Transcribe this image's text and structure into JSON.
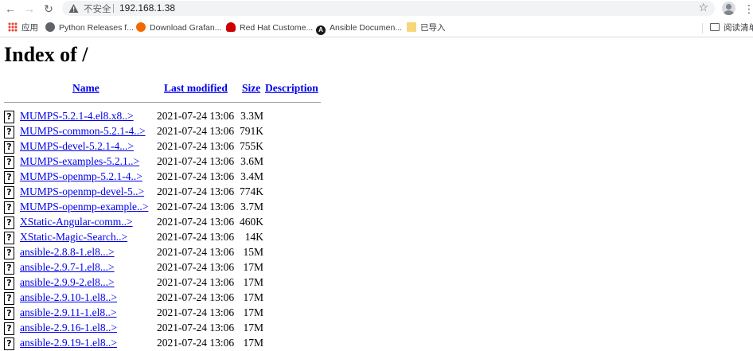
{
  "browser": {
    "security_label": "不安全",
    "url": "192.168.1.38",
    "bookmarks": [
      {
        "label": "应用",
        "icon": "apps-icon"
      },
      {
        "label": "Python Releases f...",
        "icon": "python-icon"
      },
      {
        "label": "Download Grafan...",
        "icon": "grafana-icon"
      },
      {
        "label": "Red Hat Custome...",
        "icon": "redhat-icon"
      },
      {
        "label": "Ansible Documen...",
        "icon": "ansible-icon"
      },
      {
        "label": "已导入",
        "icon": "folder-icon"
      }
    ],
    "reading_list": "阅读清单"
  },
  "page": {
    "title": "Index of /",
    "headers": {
      "name": "Name",
      "last_modified": "Last modified",
      "size": "Size",
      "description": "Description"
    },
    "icon_glyph": "?",
    "files": [
      {
        "name": "MUMPS-5.2.1-4.el8.x8..>",
        "modified": "2021-07-24 13:06",
        "size": "3.3M"
      },
      {
        "name": "MUMPS-common-5.2.1-4..>",
        "modified": "2021-07-24 13:06",
        "size": "791K"
      },
      {
        "name": "MUMPS-devel-5.2.1-4...>",
        "modified": "2021-07-24 13:06",
        "size": "755K"
      },
      {
        "name": "MUMPS-examples-5.2.1..>",
        "modified": "2021-07-24 13:06",
        "size": "3.6M"
      },
      {
        "name": "MUMPS-openmp-5.2.1-4..>",
        "modified": "2021-07-24 13:06",
        "size": "3.4M"
      },
      {
        "name": "MUMPS-openmp-devel-5..>",
        "modified": "2021-07-24 13:06",
        "size": "774K"
      },
      {
        "name": "MUMPS-openmp-example..>",
        "modified": "2021-07-24 13:06",
        "size": "3.7M"
      },
      {
        "name": "XStatic-Angular-comm..>",
        "modified": "2021-07-24 13:06",
        "size": "460K"
      },
      {
        "name": "XStatic-Magic-Search..>",
        "modified": "2021-07-24 13:06",
        "size": "14K"
      },
      {
        "name": "ansible-2.8.8-1.el8...>",
        "modified": "2021-07-24 13:06",
        "size": "15M"
      },
      {
        "name": "ansible-2.9.7-1.el8...>",
        "modified": "2021-07-24 13:06",
        "size": "17M"
      },
      {
        "name": "ansible-2.9.9-2.el8...>",
        "modified": "2021-07-24 13:06",
        "size": "17M"
      },
      {
        "name": "ansible-2.9.10-1.el8..>",
        "modified": "2021-07-24 13:06",
        "size": "17M"
      },
      {
        "name": "ansible-2.9.11-1.el8..>",
        "modified": "2021-07-24 13:06",
        "size": "17M"
      },
      {
        "name": "ansible-2.9.16-1.el8..>",
        "modified": "2021-07-24 13:06",
        "size": "17M"
      },
      {
        "name": "ansible-2.9.19-1.el8..>",
        "modified": "2021-07-24 13:06",
        "size": "17M"
      }
    ]
  }
}
